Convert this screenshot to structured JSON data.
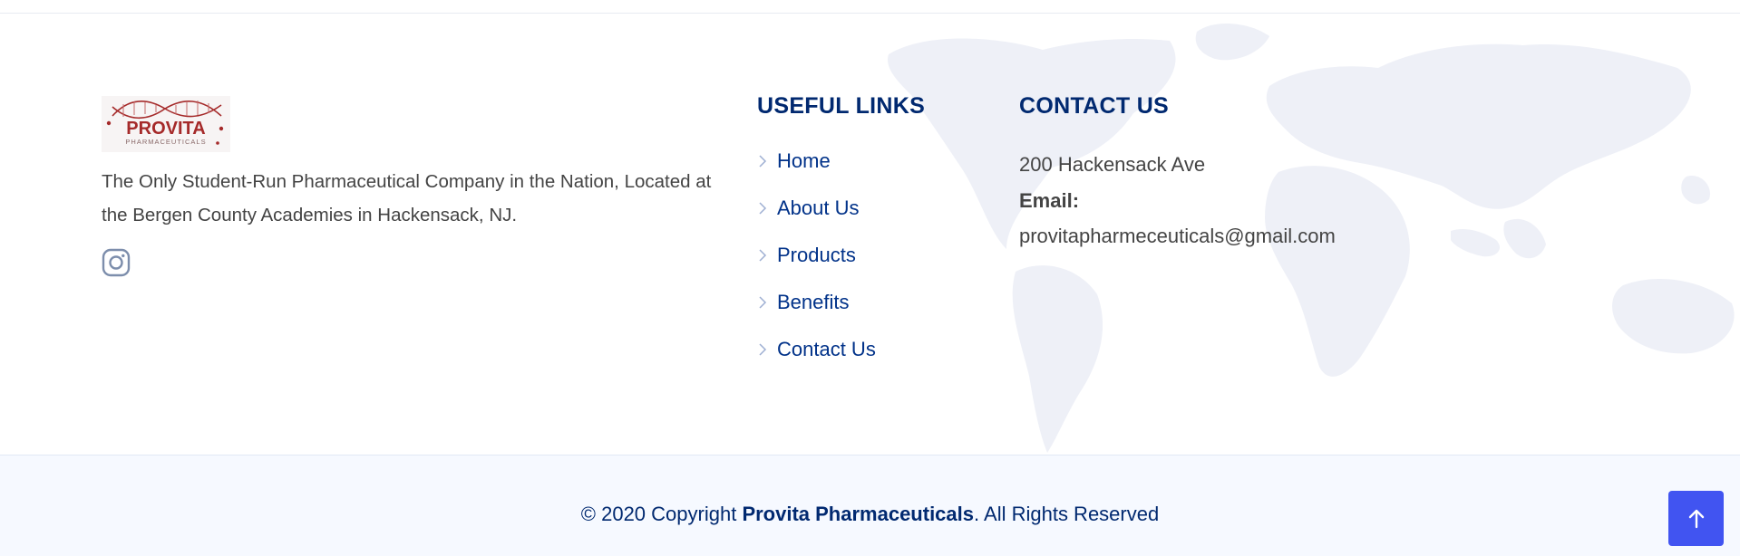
{
  "brand": {
    "logo_text": "PROVITA",
    "logo_subtext": "PHARMACEUTICALS",
    "tagline": "The Only Student-Run Pharmaceutical Company in the Nation, Located at the Bergen County Academies in Hackensack, NJ.",
    "social_icon": "instagram-icon"
  },
  "useful_links": {
    "title": "USEFUL LINKS",
    "items": [
      "Home",
      "About Us",
      "Products",
      "Benefits",
      "Contact Us"
    ],
    "icon": "chevron-right-icon"
  },
  "contact": {
    "title": "CONTACT US",
    "address": "200 Hackensack Ave",
    "email_label": "Email:",
    "email": "provitapharmeceuticals@gmail.com"
  },
  "footer": {
    "copyright_prefix": "© 2020 Copyright ",
    "company": "Provita Pharmaceuticals",
    "copyright_suffix": ". All Rights Reserved",
    "back_to_top_icon": "arrow-up-icon"
  },
  "colors": {
    "heading": "#012970",
    "link": "#013289",
    "accent": "#4154f1",
    "logo_red": "#a52a2a",
    "map": "#eef0f7",
    "bottom_bg": "#f6f9ff"
  }
}
